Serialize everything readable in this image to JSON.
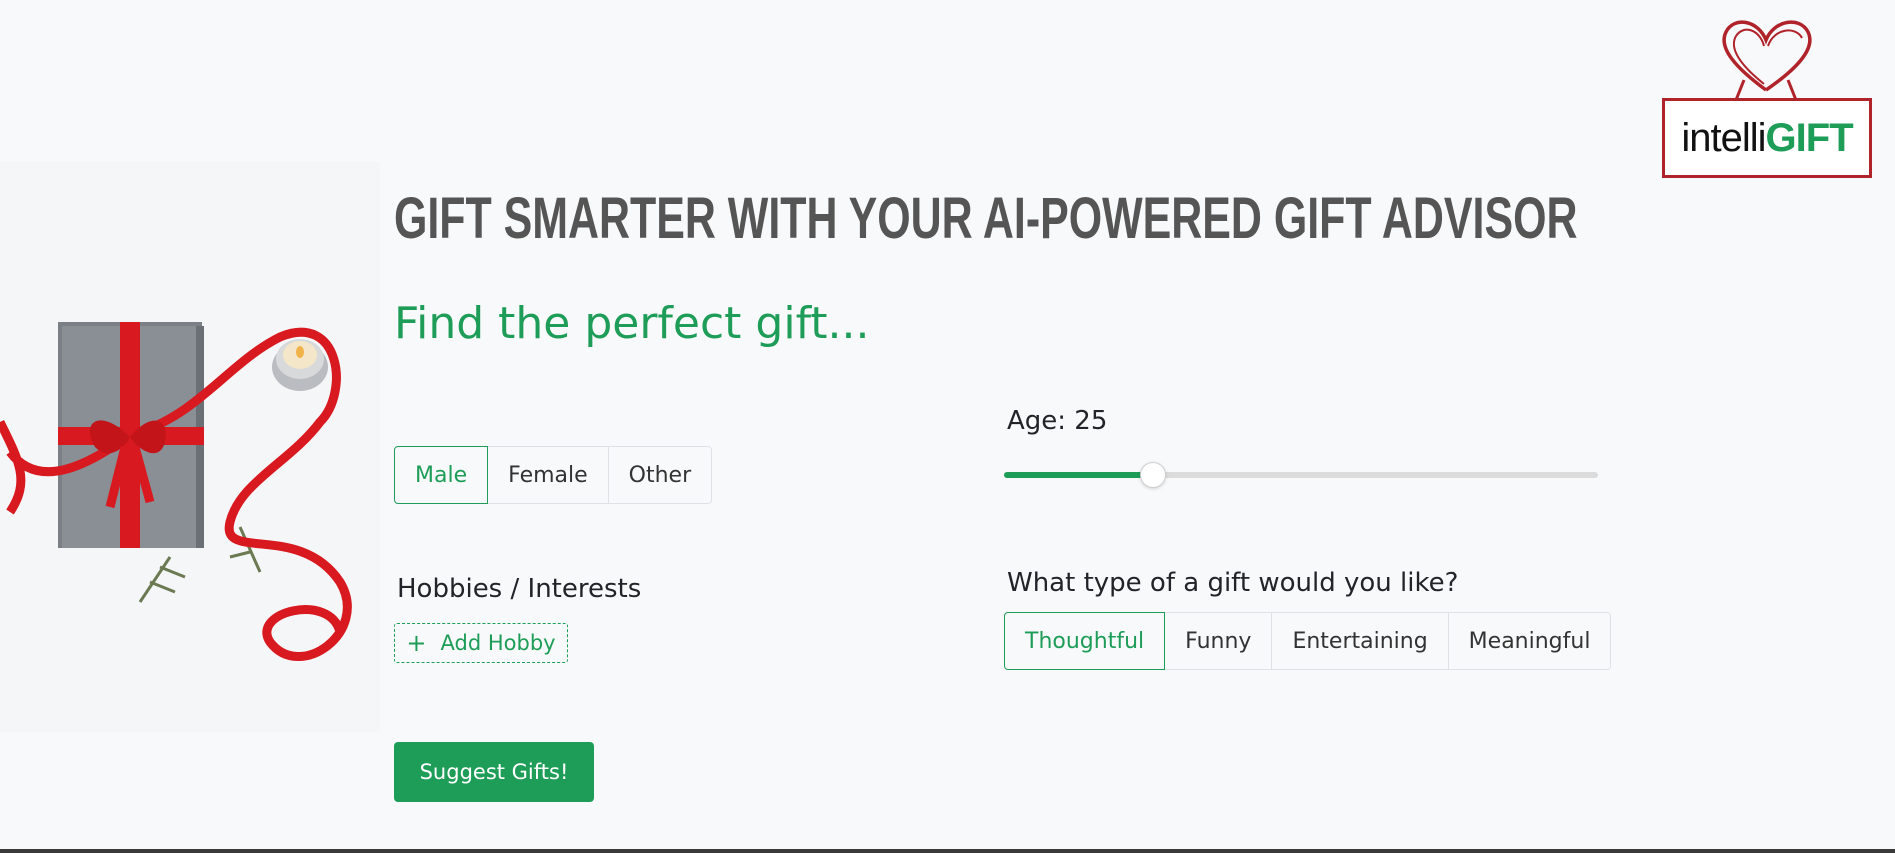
{
  "headline": "GIFT SMARTER WITH YOUR AI-POWERED GIFT ADVISOR",
  "subheadline": "Find the perfect gift...",
  "logo": {
    "word1": "intelli",
    "word2": "GIFT"
  },
  "gender": {
    "options": [
      "Male",
      "Female",
      "Other"
    ],
    "selected": "Male"
  },
  "age": {
    "label": "Age: 25",
    "value": 25,
    "fraction": 0.25
  },
  "hobbies": {
    "label": "Hobbies / Interests",
    "add_button": "Add Hobby",
    "add_icon": "+"
  },
  "gift_type": {
    "label": "What type of a gift would you like?",
    "options": [
      "Thoughtful",
      "Funny",
      "Entertaining",
      "Meaningful"
    ],
    "selected": "Thoughtful"
  },
  "suggest_button": "Suggest Gifts!",
  "colors": {
    "accent": "#1e9d58",
    "logo_red": "#b0232a",
    "headline": "#555555"
  }
}
